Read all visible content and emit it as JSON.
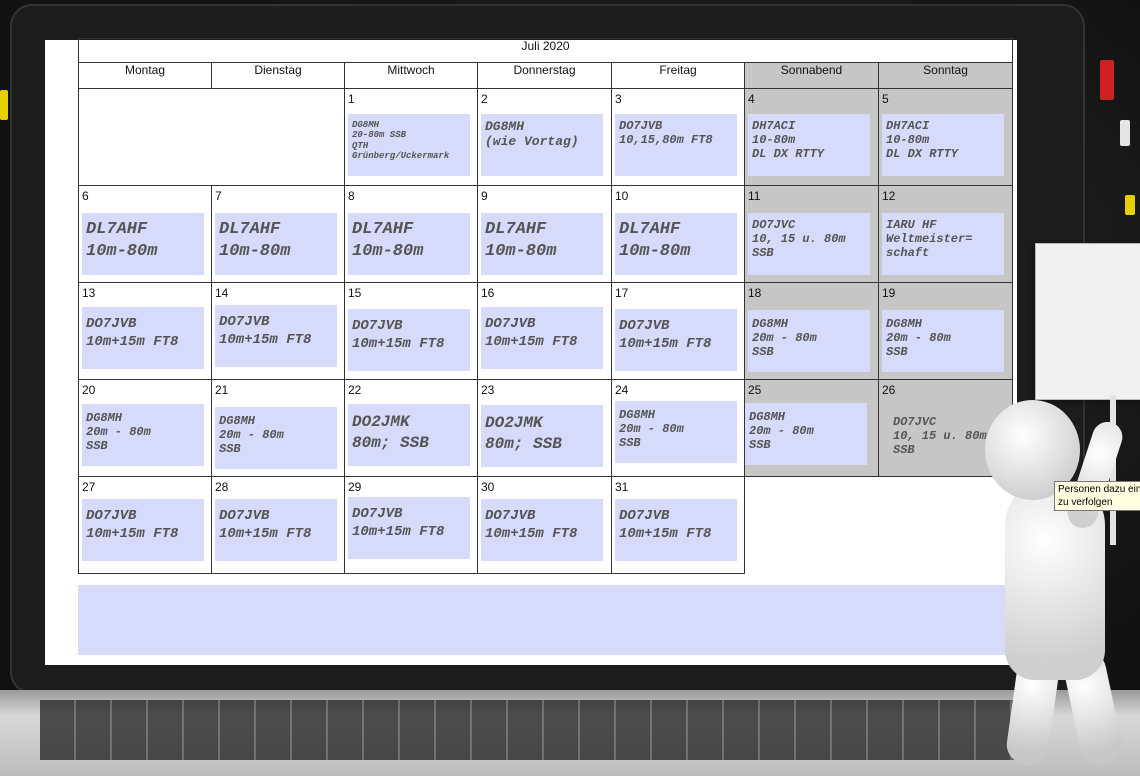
{
  "calendar": {
    "month_title": "Juli 2020",
    "weekdays": [
      "Montag",
      "Dienstag",
      "Mittwoch",
      "Donnerstag",
      "Freitag",
      "Sonnabend",
      "Sonntag"
    ],
    "days": {
      "d1": "1",
      "d2": "2",
      "d3": "3",
      "d4": "4",
      "d5": "5",
      "d6": "6",
      "d7": "7",
      "d8": "8",
      "d9": "9",
      "d10": "10",
      "d11": "11",
      "d12": "12",
      "d13": "13",
      "d14": "14",
      "d15": "15",
      "d16": "16",
      "d17": "17",
      "d18": "18",
      "d19": "19",
      "d20": "20",
      "d21": "21",
      "d22": "22",
      "d23": "23",
      "d24": "24",
      "d25": "25",
      "d26": "26",
      "d27": "27",
      "d28": "28",
      "d29": "29",
      "d30": "30",
      "d31": "31"
    },
    "events": {
      "e1": "DG8MH\n20-80m SSB\nQTH\nGrünberg/Uckermark",
      "e2": "DG8MH\n(wie Vortag)",
      "e3": "DO7JVB\n10,15,80m FT8",
      "e4": "DH7ACI\n10-80m\nDL DX RTTY",
      "e5": "DH7ACI\n10-80m\nDL DX RTTY",
      "e6": "DL7AHF\n10m-80m",
      "e7": "DL7AHF\n10m-80m",
      "e8": "DL7AHF\n10m-80m",
      "e9": "DL7AHF\n10m-80m",
      "e10": "DL7AHF\n10m-80m",
      "e11": "DO7JVC\n10, 15 u. 80m\nSSB",
      "e12": "IARU HF\nWeltmeister=\nschaft",
      "e13": "DO7JVB\n10m+15m FT8",
      "e14": "DO7JVB\n10m+15m FT8",
      "e15": "DO7JVB\n10m+15m FT8",
      "e16": "DO7JVB\n10m+15m FT8",
      "e17": "DO7JVB\n10m+15m FT8",
      "e18": "DG8MH\n20m - 80m\nSSB",
      "e19": "DG8MH\n20m - 80m\nSSB",
      "e20": "DG8MH\n20m - 80m\nSSB",
      "e21": "DG8MH\n20m - 80m\nSSB",
      "e22": "DO2JMK\n80m; SSB",
      "e23": "DO2JMK\n80m; SSB",
      "e24": "DG8MH\n20m - 80m\nSSB",
      "e25": "DG8MH\n20m - 80m\nSSB",
      "e26": "DO7JVC\n10, 15 u. 80m\nSSB",
      "e27": "DO7JVB\n10m+15m FT8",
      "e28": "DO7JVB\n10m+15m FT8",
      "e29": "DO7JVB\n10m+15m FT8",
      "e30": "DO7JVB\n10m+15m FT8",
      "e31": "DO7JVB\n10m+15m FT8"
    }
  },
  "tooltip": {
    "line1": "Personen dazu ein",
    "line2": "zu verfolgen"
  },
  "colors": {
    "event_fill": "#d6dbfb",
    "weekend_fill": "#c6c6c6"
  }
}
